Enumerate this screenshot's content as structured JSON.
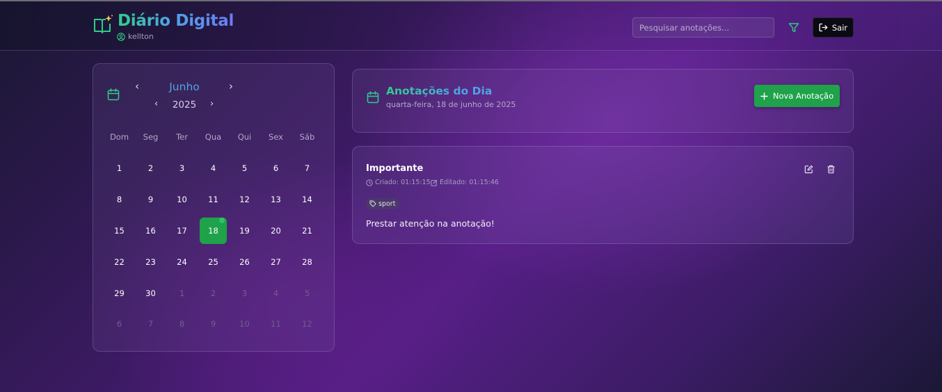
{
  "app": {
    "title": "Diário Digital",
    "username": "kellton",
    "brand_icon": "book-sparkle-icon",
    "accent_green": "#1fa24a",
    "accent_blue": "#4fa4e8"
  },
  "header": {
    "search_placeholder": "Pesquisar anotações...",
    "filter_icon": "filter-icon",
    "logout_label": "Sair"
  },
  "calendar": {
    "month": "Junho",
    "year": "2025",
    "prev_month": "‹",
    "next_month": "›",
    "prev_year": "‹",
    "next_year": "›",
    "weekdays": [
      "Dom",
      "Seg",
      "Ter",
      "Qua",
      "Qui",
      "Sex",
      "Sáb"
    ],
    "days": [
      {
        "label": "1",
        "current": true
      },
      {
        "label": "2",
        "current": true
      },
      {
        "label": "3",
        "current": true
      },
      {
        "label": "4",
        "current": true
      },
      {
        "label": "5",
        "current": true
      },
      {
        "label": "6",
        "current": true
      },
      {
        "label": "7",
        "current": true
      },
      {
        "label": "8",
        "current": true
      },
      {
        "label": "9",
        "current": true
      },
      {
        "label": "10",
        "current": true
      },
      {
        "label": "11",
        "current": true
      },
      {
        "label": "12",
        "current": true
      },
      {
        "label": "13",
        "current": true
      },
      {
        "label": "14",
        "current": true
      },
      {
        "label": "15",
        "current": true
      },
      {
        "label": "16",
        "current": true
      },
      {
        "label": "17",
        "current": true
      },
      {
        "label": "18",
        "current": true,
        "selected": true,
        "has_note": true
      },
      {
        "label": "19",
        "current": true
      },
      {
        "label": "20",
        "current": true
      },
      {
        "label": "21",
        "current": true
      },
      {
        "label": "22",
        "current": true
      },
      {
        "label": "23",
        "current": true
      },
      {
        "label": "24",
        "current": true
      },
      {
        "label": "25",
        "current": true
      },
      {
        "label": "26",
        "current": true
      },
      {
        "label": "27",
        "current": true
      },
      {
        "label": "28",
        "current": true
      },
      {
        "label": "29",
        "current": true
      },
      {
        "label": "30",
        "current": true
      },
      {
        "label": "1",
        "current": false
      },
      {
        "label": "2",
        "current": false
      },
      {
        "label": "3",
        "current": false
      },
      {
        "label": "4",
        "current": false
      },
      {
        "label": "5",
        "current": false
      },
      {
        "label": "6",
        "current": false
      },
      {
        "label": "7",
        "current": false
      },
      {
        "label": "8",
        "current": false
      },
      {
        "label": "9",
        "current": false
      },
      {
        "label": "10",
        "current": false
      },
      {
        "label": "11",
        "current": false
      },
      {
        "label": "12",
        "current": false
      }
    ]
  },
  "notes_panel": {
    "title": "Anotações do Dia",
    "date": "quarta-feira, 18 de junho de 2025",
    "new_button": "Nova Anotação"
  },
  "notes": [
    {
      "title": "Importante",
      "created": "Criado: 01:15:15",
      "edited": "Editado: 01:15:46",
      "tag": "sport",
      "body": "Prestar atenção na anotação!"
    }
  ]
}
